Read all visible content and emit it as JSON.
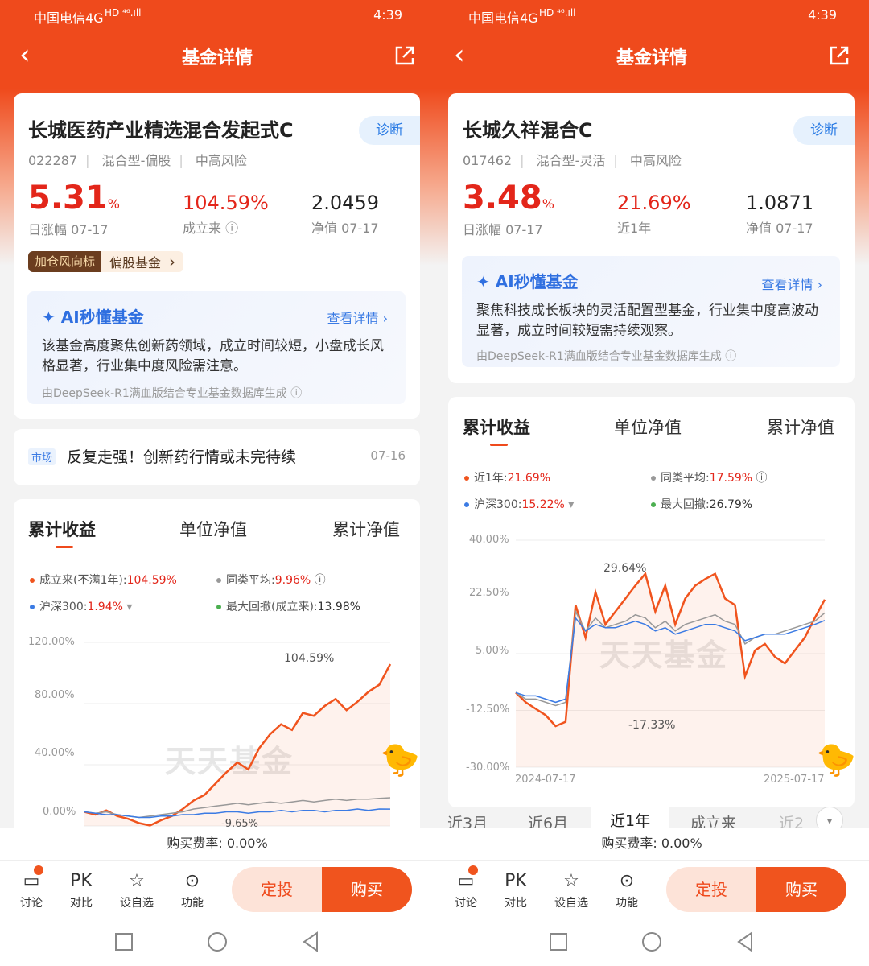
{
  "status": {
    "carrier": "中国电信4G",
    "network": "HD ⁴⁶.ıll",
    "time": "4:39"
  },
  "nav": {
    "title": "基金详情",
    "back": "‹"
  },
  "left": {
    "fund": {
      "name": "长城医药产业精选混合发起式C",
      "code": "022287",
      "type": "混合型-偏股",
      "risk": "中高风险",
      "diagnose": "诊断"
    },
    "metrics": [
      {
        "value": "5.31",
        "unit": "%",
        "label": "日涨幅 07-17"
      },
      {
        "value": "104.59%",
        "label": "成立来 ⓘ"
      },
      {
        "value": "2.0459",
        "label": "净值 07-17"
      }
    ],
    "tag": {
      "badge": "加仓风向标",
      "text": "偏股基金",
      "arrow": "›"
    },
    "ai": {
      "title": "AI秒懂基金",
      "link": "查看详情 ›",
      "text": "该基金高度聚焦创新药领域，成立时间较短，小盘成长风格显著，行业集中度风险需注意。",
      "foot": "由DeepSeek-R1满血版结合专业基金数据库生成 ⓘ"
    },
    "news": {
      "tag": "市场",
      "text": "反复走强！创新药行情或未完待续",
      "date": "07-16"
    },
    "chart": {
      "tabs": [
        "累计收益",
        "单位净值",
        "累计净值"
      ],
      "legend": [
        {
          "label": "成立来(不满1年):",
          "value": "104.59%",
          "color": "#f0541e"
        },
        {
          "label": "同类平均:",
          "value": "9.96%",
          "suffix": " ⓘ",
          "color": "#999999"
        },
        {
          "label": "沪深300:",
          "value": "1.94%",
          "suffix": " ▾",
          "color": "#3b7be4"
        },
        {
          "label": "最大回撤(成立来):",
          "value": "13.98%",
          "color": "#4caf50",
          "black": true
        }
      ],
      "y_ticks": [
        "120.00%",
        "80.00%",
        "40.00%",
        "0.00%"
      ],
      "peak_label": "104.59%",
      "trough_label": "-9.65%",
      "watermark": "天天基金"
    },
    "chart_data": {
      "type": "line",
      "ylim": [
        -10,
        120
      ],
      "series": [
        {
          "name": "成立来(不满1年)",
          "values": [
            0,
            -2,
            1,
            -3,
            -5,
            -8,
            -9.65,
            -6,
            -3,
            2,
            8,
            12,
            20,
            28,
            35,
            30,
            45,
            55,
            62,
            58,
            70,
            68,
            75,
            80,
            72,
            78,
            85,
            90,
            104.59
          ]
        },
        {
          "name": "同类平均",
          "values": [
            0,
            -1,
            0,
            -2,
            -3,
            -4,
            -3,
            -2,
            -1,
            0,
            2,
            3,
            4,
            5,
            6,
            5,
            6,
            7,
            6,
            7,
            8,
            7,
            8,
            9,
            8,
            9,
            9,
            9.5,
            9.96
          ]
        },
        {
          "name": "沪深300",
          "values": [
            0,
            -1,
            -2,
            -2,
            -3,
            -4,
            -4,
            -3,
            -3,
            -2,
            -2,
            -1,
            -1,
            0,
            0,
            -1,
            0,
            0,
            1,
            0,
            1,
            1,
            0,
            1,
            1,
            2,
            1,
            2,
            1.94
          ]
        }
      ]
    }
  },
  "right": {
    "fund": {
      "name": "长城久祥混合C",
      "code": "017462",
      "type": "混合型-灵活",
      "risk": "中高风险",
      "diagnose": "诊断"
    },
    "metrics": [
      {
        "value": "3.48",
        "unit": "%",
        "label": "日涨幅 07-17"
      },
      {
        "value": "21.69%",
        "label": "近1年"
      },
      {
        "value": "1.0871",
        "label": "净值 07-17"
      }
    ],
    "ai": {
      "title": "AI秒懂基金",
      "link": "查看详情 ›",
      "text": "聚焦科技成长板块的灵活配置型基金，行业集中度高波动显著，成立时间较短需持续观察。",
      "foot": "由DeepSeek-R1满血版结合专业基金数据库生成 ⓘ"
    },
    "chart": {
      "tabs": [
        "累计收益",
        "单位净值",
        "累计净值"
      ],
      "legend": [
        {
          "label": "近1年:",
          "value": "21.69%",
          "color": "#f0541e"
        },
        {
          "label": "同类平均:",
          "value": "17.59%",
          "suffix": " ⓘ",
          "color": "#999999"
        },
        {
          "label": "沪深300:",
          "value": "15.22%",
          "suffix": " ▾",
          "color": "#3b7be4"
        },
        {
          "label": "最大回撤:",
          "value": "26.79%",
          "color": "#4caf50",
          "black": true
        }
      ],
      "y_ticks": [
        "40.00%",
        "22.50%",
        "5.00%",
        "-12.50%",
        "-30.00%"
      ],
      "x_ticks": [
        "2024-07-17",
        "2025-07-17"
      ],
      "peak_label": "29.64%",
      "trough_label": "-17.33%",
      "watermark": "天天基金"
    },
    "chart_data": {
      "type": "line",
      "ylim": [
        -30,
        40
      ],
      "x": [
        "2024-07-17",
        "2025-07-17"
      ],
      "series": [
        {
          "name": "近1年",
          "values": [
            -7,
            -10,
            -12,
            -14,
            -17.33,
            -16,
            20,
            10,
            24,
            14,
            18,
            22,
            26,
            29.64,
            18,
            26,
            14,
            22,
            26,
            28,
            29.64,
            22,
            20,
            -2,
            6,
            8,
            4,
            2,
            6,
            10,
            16,
            21.69
          ]
        },
        {
          "name": "同类平均",
          "values": [
            -7,
            -9,
            -9,
            -10,
            -11,
            -10,
            18,
            12,
            16,
            13,
            14,
            15,
            17,
            16,
            13,
            15,
            12,
            14,
            15,
            16,
            17,
            15,
            14,
            8,
            10,
            11,
            11,
            12,
            13,
            14,
            15,
            17.59
          ]
        },
        {
          "name": "沪深300",
          "values": [
            -7,
            -8,
            -8,
            -9,
            -10,
            -9,
            16,
            12,
            14,
            13,
            13,
            14,
            15,
            14,
            12,
            13,
            11,
            12,
            13,
            14,
            14,
            13,
            12,
            9,
            10,
            11,
            11,
            11,
            12,
            13,
            14,
            15.22
          ]
        }
      ]
    },
    "ranges": [
      "近3月",
      "近6月",
      "近1年",
      "成立来",
      "近2"
    ]
  },
  "fee": "购买费率: 0.00%",
  "bottom": {
    "discuss": "讨论",
    "pk_icon": "PK",
    "pk": "对比",
    "watch": "设自选",
    "func": "功能",
    "dingtou": "定投",
    "buy": "购买"
  },
  "colors": {
    "accent": "#ef4a1c",
    "up": "#e3261a",
    "link": "#2f6fe0"
  }
}
